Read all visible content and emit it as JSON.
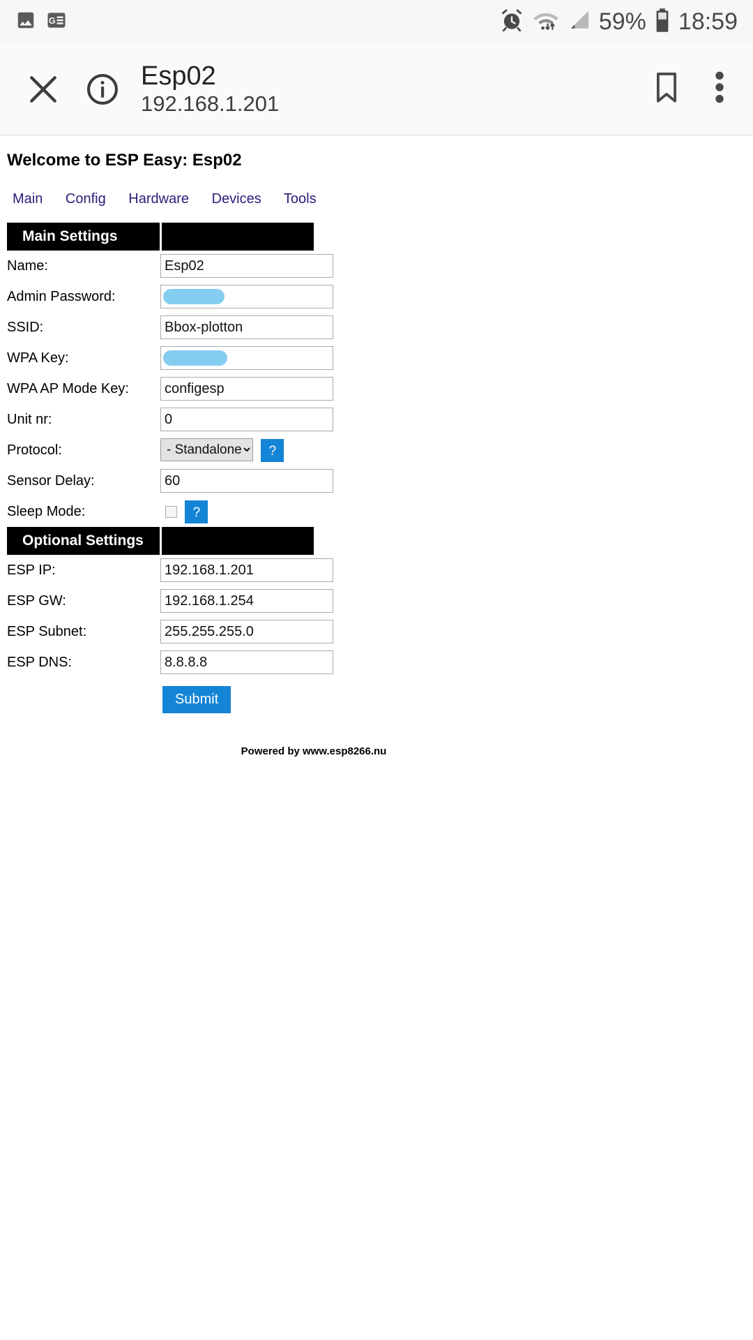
{
  "status_bar": {
    "left_icons": [
      "image-icon",
      "google-news-icon"
    ],
    "right_icons": [
      "alarm-icon",
      "wifi-icon",
      "signal-icon",
      "battery-icon"
    ],
    "battery_percent": "59%",
    "time": "18:59"
  },
  "browser_header": {
    "close_icon": "close-icon",
    "info_icon": "info-circle-icon",
    "title": "Esp02",
    "url": "192.168.1.201",
    "bookmark_icon": "bookmark-icon",
    "overflow_icon": "more-vertical-icon"
  },
  "page": {
    "welcome": "Welcome to ESP Easy: Esp02",
    "nav": [
      {
        "label": "Main"
      },
      {
        "label": "Config"
      },
      {
        "label": "Hardware"
      },
      {
        "label": "Devices"
      },
      {
        "label": "Tools"
      }
    ],
    "main_settings": {
      "section_title": "Main Settings",
      "fields": {
        "name": {
          "label": "Name:",
          "value": "Esp02"
        },
        "admin_password": {
          "label": "Admin Password:",
          "value": "",
          "redacted": true
        },
        "ssid": {
          "label": "SSID:",
          "value": "Bbox-plotton"
        },
        "wpa_key": {
          "label": "WPA Key:",
          "value": "",
          "redacted": true
        },
        "wpa_ap_mode_key": {
          "label": "WPA AP Mode Key:",
          "value": "configesp"
        },
        "unit_nr": {
          "label": "Unit nr:",
          "value": "0"
        },
        "protocol": {
          "label": "Protocol:",
          "selected": "- Standalone -",
          "options": [
            "- Standalone -"
          ],
          "help_label": "?"
        },
        "sensor_delay": {
          "label": "Sensor Delay:",
          "value": "60"
        },
        "sleep_mode": {
          "label": "Sleep Mode:",
          "checked": false,
          "help_label": "?"
        }
      }
    },
    "optional_settings": {
      "section_title": "Optional Settings",
      "fields": {
        "esp_ip": {
          "label": "ESP IP:",
          "value": "192.168.1.201"
        },
        "esp_gw": {
          "label": "ESP GW:",
          "value": "192.168.1.254"
        },
        "esp_subnet": {
          "label": "ESP Subnet:",
          "value": "255.255.255.0"
        },
        "esp_dns": {
          "label": "ESP DNS:",
          "value": "8.8.8.8"
        }
      }
    },
    "submit_label": "Submit",
    "footer": "Powered by www.esp8266.nu"
  },
  "colors": {
    "accent_blue": "#1484d6",
    "link_navy": "#27207a",
    "section_black": "#000000",
    "redaction_blue": "#85cdf0"
  }
}
